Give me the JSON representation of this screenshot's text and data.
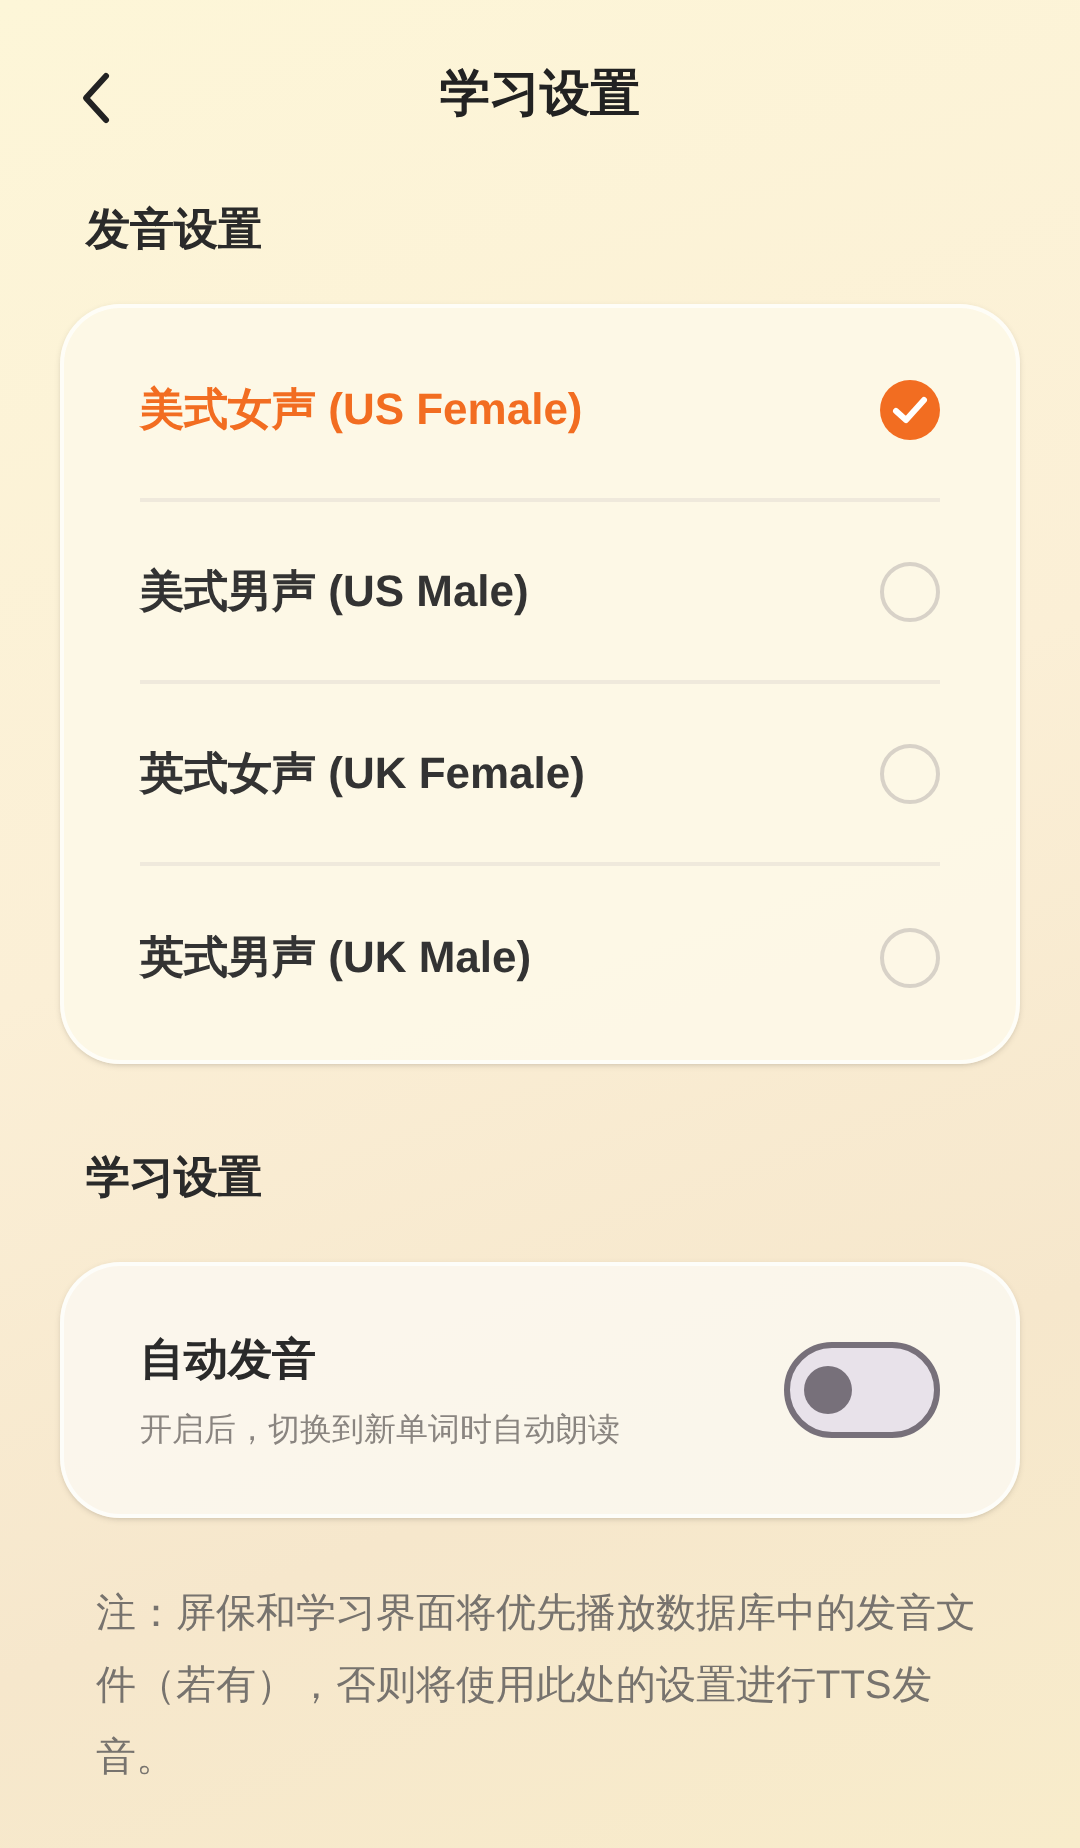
{
  "header": {
    "title": "学习设置"
  },
  "voice_section": {
    "title": "发音设置",
    "options": [
      {
        "label": "美式女声 (US Female)",
        "selected": true
      },
      {
        "label": "美式男声 (US Male)",
        "selected": false
      },
      {
        "label": "英式女声 (UK Female)",
        "selected": false
      },
      {
        "label": "英式男声 (UK Male)",
        "selected": false
      }
    ]
  },
  "study_section": {
    "title": "学习设置",
    "settings": [
      {
        "label": "自动发音",
        "description": "开启后，切换到新单词时自动朗读",
        "on": false
      }
    ]
  },
  "note": "注：屏保和学习界面将优先播放数据库中的发音文件（若有），否则将使用此处的设置进行TTS发音。"
}
